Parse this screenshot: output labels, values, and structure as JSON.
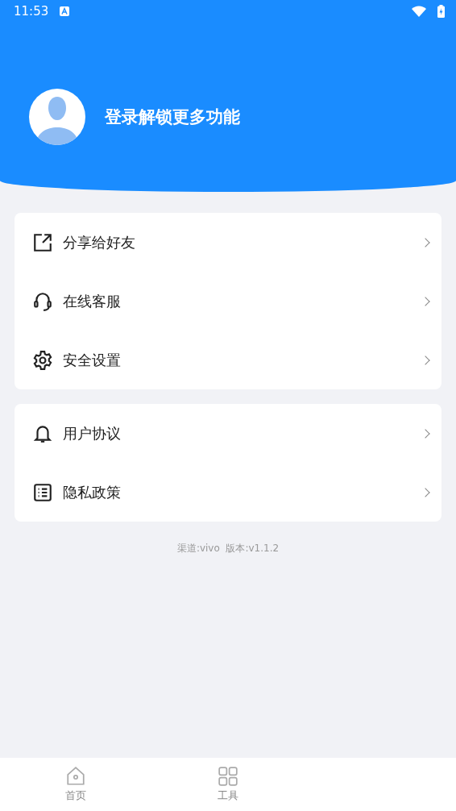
{
  "status_bar": {
    "time": "11:53"
  },
  "profile": {
    "login_prompt": "登录解锁更多功能"
  },
  "menu_groups": [
    {
      "items": [
        {
          "kind": "share",
          "label": "分享给好友"
        },
        {
          "kind": "headset",
          "label": "在线客服"
        },
        {
          "kind": "gear",
          "label": "安全设置"
        }
      ]
    },
    {
      "items": [
        {
          "kind": "bell",
          "label": "用户协议"
        },
        {
          "kind": "list",
          "label": "隐私政策"
        }
      ]
    }
  ],
  "version_info": "渠道:vivo  版本:v1.1.2",
  "bottom_nav": [
    {
      "kind": "home",
      "label": "首页",
      "selected": false
    },
    {
      "kind": "grid",
      "label": "工具",
      "selected": false
    }
  ]
}
